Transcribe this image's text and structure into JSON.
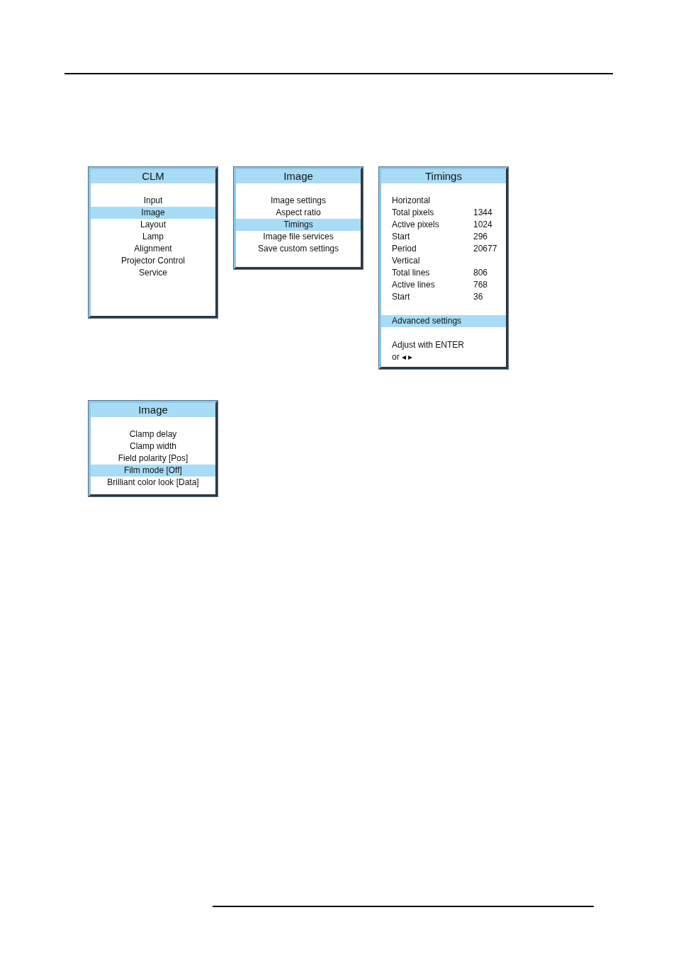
{
  "menus": [
    {
      "kind": "list",
      "title": "CLM",
      "items": [
        {
          "label": "Input",
          "selected": false
        },
        {
          "label": "Image",
          "selected": true
        },
        {
          "label": "Layout",
          "selected": false
        },
        {
          "label": "Lamp",
          "selected": false
        },
        {
          "label": "Alignment",
          "selected": false
        },
        {
          "label": "Projector Control",
          "selected": false
        },
        {
          "label": "Service",
          "selected": false
        }
      ]
    },
    {
      "kind": "list",
      "title": "Image",
      "items": [
        {
          "label": "Image settings",
          "selected": false
        },
        {
          "label": "Aspect ratio",
          "selected": false
        },
        {
          "label": "Timings",
          "selected": true
        },
        {
          "label": "Image file services",
          "selected": false
        },
        {
          "label": "Save custom settings",
          "selected": false
        }
      ]
    },
    {
      "kind": "readout",
      "title": "Timings",
      "items": [
        {
          "kind": "heading",
          "label": "Horizontal"
        },
        {
          "kind": "reading",
          "label": "Total pixels",
          "value": "1344"
        },
        {
          "kind": "reading",
          "label": "Active pixels",
          "value": "1024"
        },
        {
          "kind": "reading",
          "label": "Start",
          "value": "296"
        },
        {
          "kind": "reading",
          "label": "Period",
          "value": "20677"
        },
        {
          "kind": "heading",
          "label": "Vertical"
        },
        {
          "kind": "reading",
          "label": "Total lines",
          "value": "806"
        },
        {
          "kind": "reading",
          "label": "Active lines",
          "value": "768"
        },
        {
          "kind": "reading",
          "label": "Start",
          "value": "36"
        },
        {
          "kind": "action",
          "label": "Advanced settings",
          "selected": true
        },
        {
          "kind": "note",
          "label": "Adjust with ENTER"
        },
        {
          "kind": "note",
          "label": "or ◂ ▸"
        }
      ]
    },
    {
      "kind": "list",
      "title": "Image",
      "items": [
        {
          "label": "Clamp delay",
          "selected": false
        },
        {
          "label": "Clamp width",
          "selected": false
        },
        {
          "label": "Field polarity [Pos]",
          "selected": false
        },
        {
          "label": "Film mode [Off]",
          "selected": true
        },
        {
          "label": "Brilliant color look [Data]",
          "selected": false
        }
      ]
    }
  ]
}
